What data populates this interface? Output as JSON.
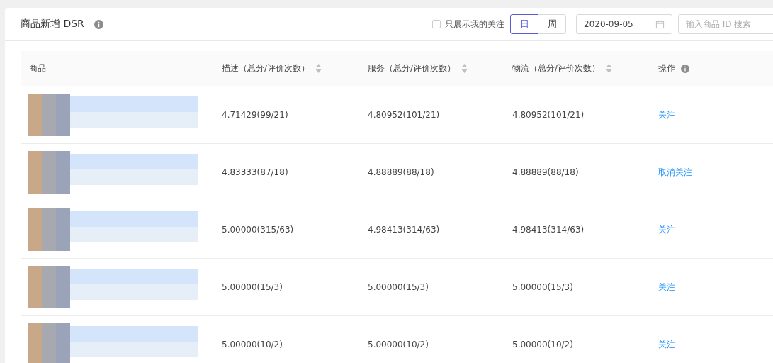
{
  "card": {
    "title": "商品新增 DSR"
  },
  "filters": {
    "only_mine": {
      "label": "只展示我的关注",
      "checked": false
    },
    "period_tabs": [
      {
        "label": "日",
        "selected": true
      },
      {
        "label": "周",
        "selected": false
      }
    ],
    "date": {
      "value": "2020-09-05"
    },
    "search": {
      "placeholder": "输入商品 ID 搜索"
    }
  },
  "table": {
    "columns": [
      {
        "label": "商品",
        "kind": "plain"
      },
      {
        "label": "描述（总分/评价次数）",
        "kind": "sortable"
      },
      {
        "label": "服务（总分/评价次数）",
        "kind": "sortable"
      },
      {
        "label": "物流（总分/评价次数）",
        "kind": "sortable"
      },
      {
        "label": "操作",
        "kind": "info"
      }
    ],
    "rows": [
      {
        "description": "4.71429(99/21)",
        "service": "4.80952(101/21)",
        "logistics": "4.80952(101/21)",
        "action": "关注"
      },
      {
        "description": "4.83333(87/18)",
        "service": "4.88889(88/18)",
        "logistics": "4.88889(88/18)",
        "action": "取消关注"
      },
      {
        "description": "5.00000(315/63)",
        "service": "4.98413(314/63)",
        "logistics": "4.98413(314/63)",
        "action": "关注"
      },
      {
        "description": "5.00000(15/3)",
        "service": "5.00000(15/3)",
        "logistics": "5.00000(15/3)",
        "action": "关注"
      },
      {
        "description": "5.00000(10/2)",
        "service": "5.00000(10/2)",
        "logistics": "5.00000(10/2)",
        "action": "关注"
      }
    ]
  }
}
